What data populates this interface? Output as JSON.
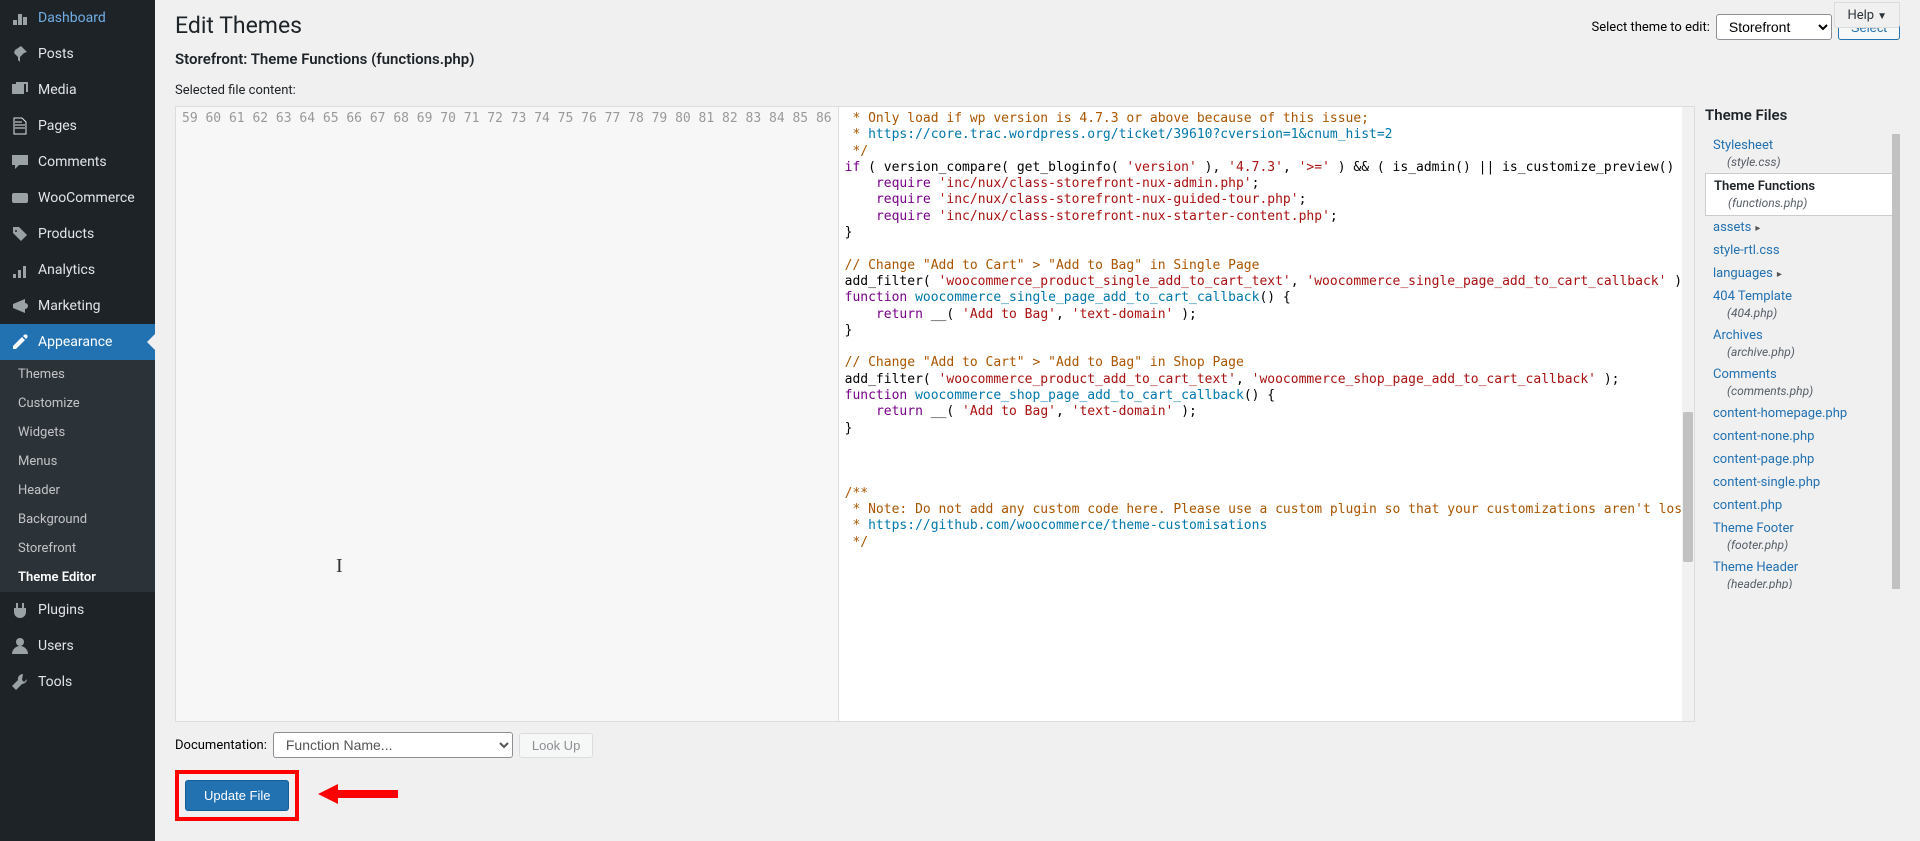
{
  "help_label": "Help",
  "page_title": "Edit Themes",
  "subtitle": "Storefront: Theme Functions (functions.php)",
  "select_theme_label": "Select theme to edit:",
  "select_theme_value": "Storefront",
  "select_button": "Select",
  "selected_file_label": "Selected file content:",
  "doc_label": "Documentation:",
  "doc_placeholder": "Function Name...",
  "lookup_button": "Look Up",
  "update_button": "Update File",
  "sidebar": [
    {
      "icon": "dashboard",
      "label": "Dashboard"
    },
    {
      "icon": "pin",
      "label": "Posts"
    },
    {
      "icon": "media",
      "label": "Media"
    },
    {
      "icon": "page",
      "label": "Pages"
    },
    {
      "icon": "comment",
      "label": "Comments"
    },
    {
      "icon": "woo",
      "label": "WooCommerce"
    },
    {
      "icon": "product",
      "label": "Products"
    },
    {
      "icon": "analytics",
      "label": "Analytics"
    },
    {
      "icon": "marketing",
      "label": "Marketing"
    },
    {
      "icon": "appearance",
      "label": "Appearance",
      "active": true
    },
    {
      "icon": "plugin",
      "label": "Plugins"
    },
    {
      "icon": "user",
      "label": "Users"
    },
    {
      "icon": "tool",
      "label": "Tools"
    }
  ],
  "submenu": [
    "Themes",
    "Customize",
    "Widgets",
    "Menus",
    "Header",
    "Background",
    "Storefront",
    "Theme Editor"
  ],
  "submenu_current": "Theme Editor",
  "code_lines": [
    {
      "n": 59,
      "html": "<span class='c-comment'> * Only load if wp version is 4.7.3 or above because of this issue;</span>"
    },
    {
      "n": 60,
      "html": "<span class='c-comment'> * </span><span class='c-link'>https://core.trac.wordpress.org/ticket/39610?cversion=1&amp;cnum_hist=2</span>"
    },
    {
      "n": 61,
      "html": "<span class='c-comment'> */</span>"
    },
    {
      "n": 62,
      "html": "<span class='c-key'>if</span> ( version_compare( get_bloginfo( <span class='c-str'>'version'</span> ), <span class='c-str'>'4.7.3'</span>, <span class='c-str'>'&gt;='</span> ) &amp;&amp; ( is_admin() || is_customize_preview() ) ) {"
    },
    {
      "n": 63,
      "html": "    <span class='c-key'>require</span> <span class='c-str'>'inc/nux/class-storefront-nux-admin.php'</span>;"
    },
    {
      "n": 64,
      "html": "    <span class='c-key'>require</span> <span class='c-str'>'inc/nux/class-storefront-nux-guided-tour.php'</span>;"
    },
    {
      "n": 65,
      "html": "    <span class='c-key'>require</span> <span class='c-str'>'inc/nux/class-storefront-nux-starter-content.php'</span>;"
    },
    {
      "n": 66,
      "html": "}"
    },
    {
      "n": 67,
      "html": ""
    },
    {
      "n": 68,
      "html": "<span class='c-comment'>// Change \"Add to Cart\" &gt; \"Add to Bag\" in Single Page</span>"
    },
    {
      "n": 69,
      "html": "add_filter( <span class='c-str'>'woocommerce_product_single_add_to_cart_text'</span>, <span class='c-str'>'woocommerce_single_page_add_to_cart_callback'</span> );"
    },
    {
      "n": 70,
      "html": "<span class='c-key'>function</span> <span class='c-func'>woocommerce_single_page_add_to_cart_callback</span>() {"
    },
    {
      "n": 71,
      "html": "    <span class='c-key'>return</span> __( <span class='c-str'>'Add to Bag'</span>, <span class='c-str'>'text-domain'</span> );"
    },
    {
      "n": 72,
      "html": "}"
    },
    {
      "n": 73,
      "html": ""
    },
    {
      "n": 74,
      "html": "<span class='c-comment'>// Change \"Add to Cart\" &gt; \"Add to Bag\" in Shop Page</span>"
    },
    {
      "n": 75,
      "html": "add_filter( <span class='c-str'>'woocommerce_product_add_to_cart_text'</span>, <span class='c-str'>'woocommerce_shop_page_add_to_cart_callback'</span> );"
    },
    {
      "n": 76,
      "html": "<span class='c-key'>function</span> <span class='c-func'>woocommerce_shop_page_add_to_cart_callback</span>() {"
    },
    {
      "n": 77,
      "html": "    <span class='c-key'>return</span> __( <span class='c-str'>'Add to Bag'</span>, <span class='c-str'>'text-domain'</span> );"
    },
    {
      "n": 78,
      "html": "}"
    },
    {
      "n": 79,
      "html": ""
    },
    {
      "n": 80,
      "html": ""
    },
    {
      "n": 81,
      "html": ""
    },
    {
      "n": 82,
      "html": "<span class='c-comment'>/**</span>"
    },
    {
      "n": 83,
      "html": "<span class='c-comment'> * Note: Do not add any custom code here. Please use a custom plugin so that your customizations aren't lost during updates.</span>"
    },
    {
      "n": 84,
      "html": "<span class='c-comment'> * </span><span class='c-link'>https://github.com/woocommerce/theme-customisations</span>"
    },
    {
      "n": 85,
      "html": "<span class='c-comment'> */</span>"
    },
    {
      "n": 86,
      "html": ""
    }
  ],
  "theme_files_title": "Theme Files",
  "theme_files": [
    {
      "name": "Stylesheet",
      "sub": "(style.css)"
    },
    {
      "name": "Theme Functions",
      "sub": "(functions.php)",
      "active": true
    },
    {
      "name": "assets",
      "folder": true
    },
    {
      "name": "style-rtl.css"
    },
    {
      "name": "languages",
      "folder": true
    },
    {
      "name": "404 Template",
      "sub": "(404.php)"
    },
    {
      "name": "Archives",
      "sub": "(archive.php)"
    },
    {
      "name": "Comments",
      "sub": "(comments.php)"
    },
    {
      "name": "content-homepage.php"
    },
    {
      "name": "content-none.php"
    },
    {
      "name": "content-page.php"
    },
    {
      "name": "content-single.php"
    },
    {
      "name": "content.php"
    },
    {
      "name": "Theme Footer",
      "sub": "(footer.php)"
    },
    {
      "name": "Theme Header",
      "sub": "(header.php)"
    }
  ]
}
